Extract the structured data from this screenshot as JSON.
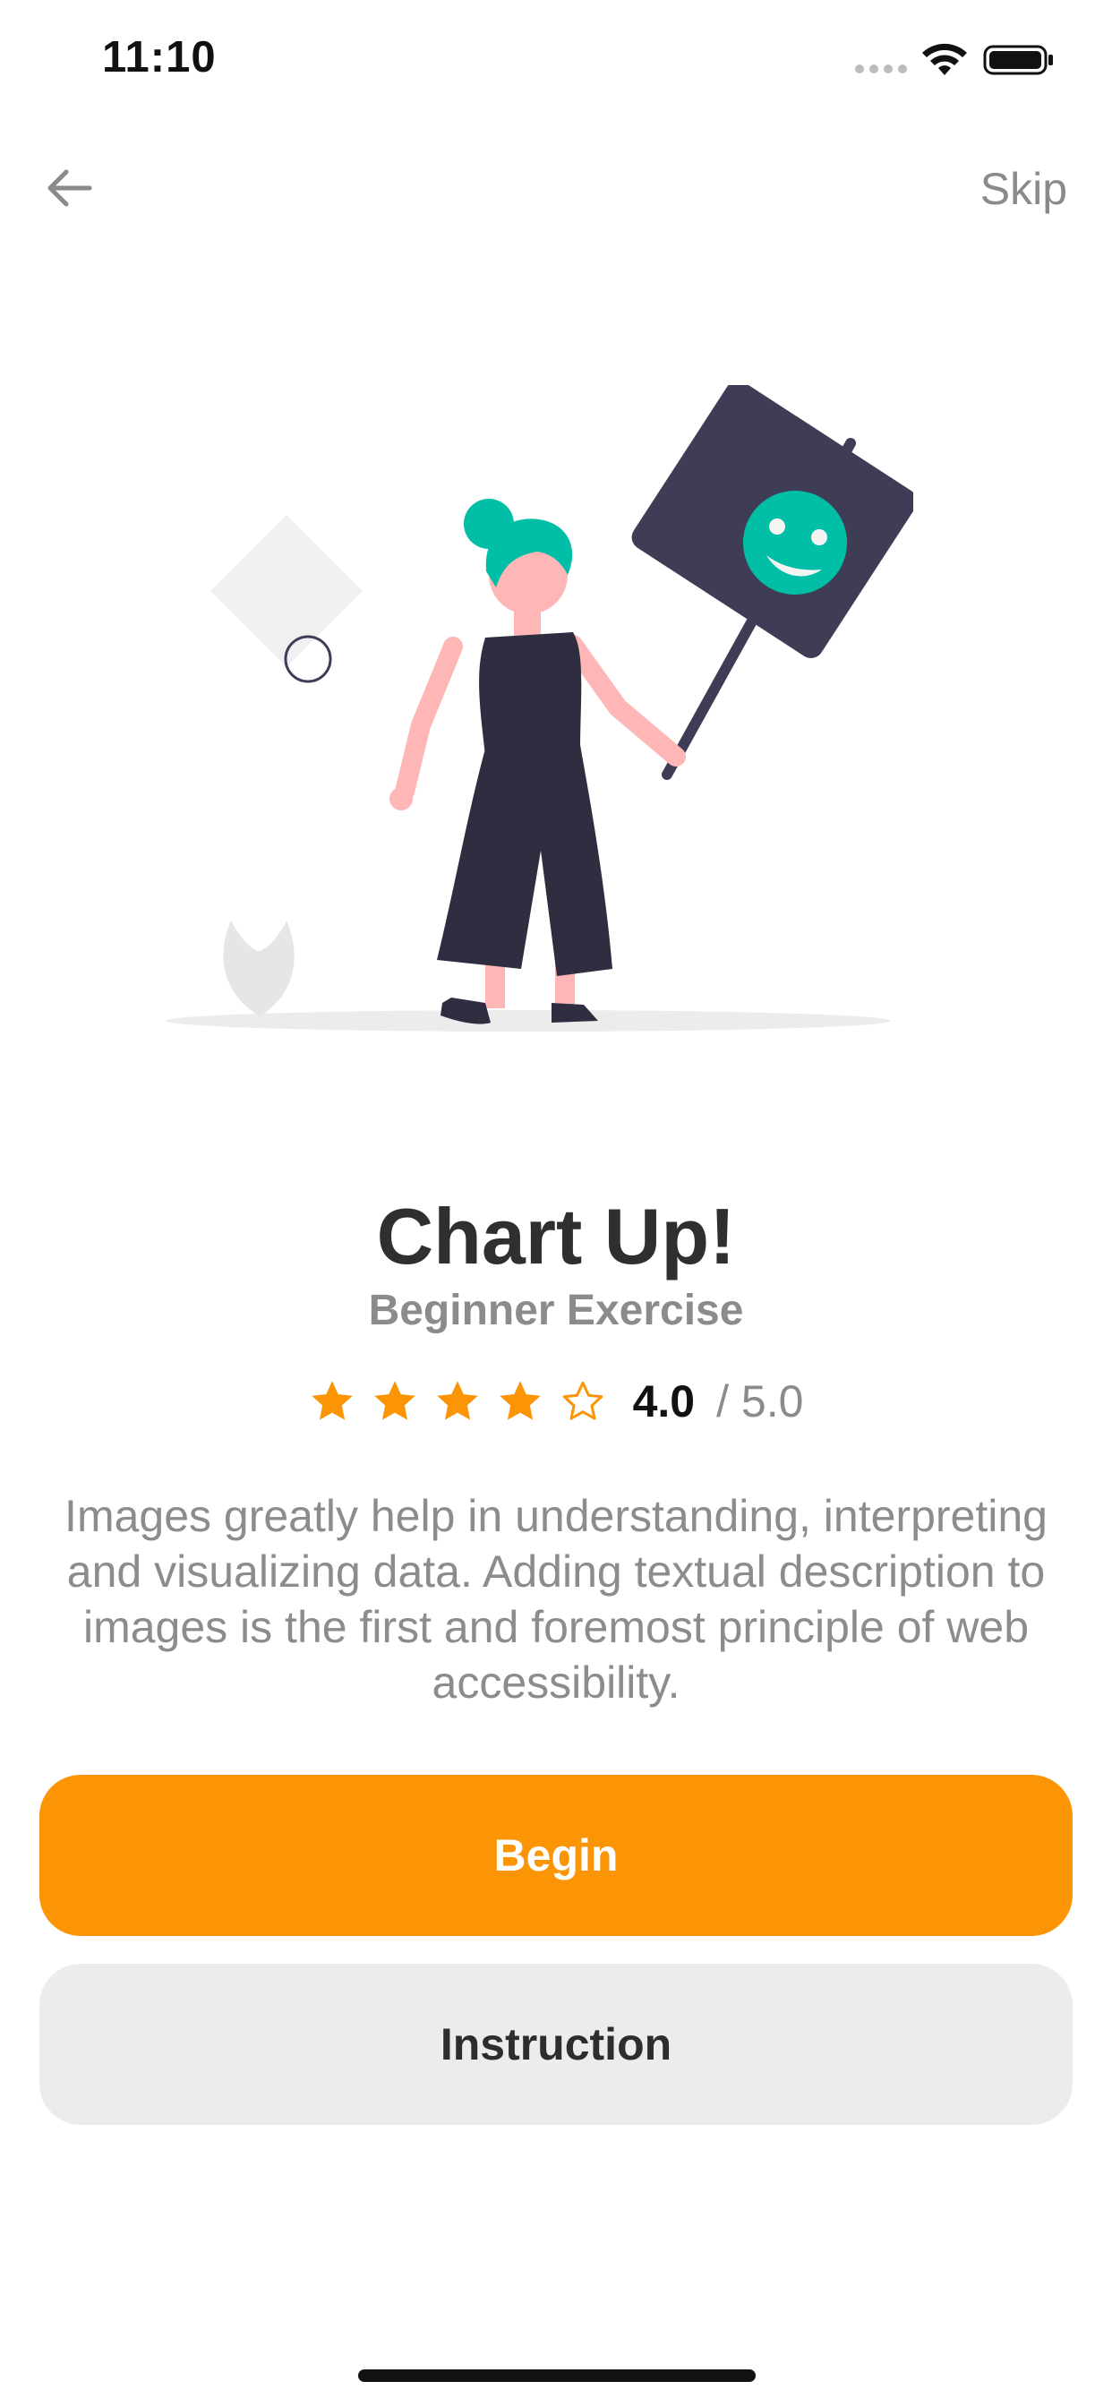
{
  "status_bar": {
    "time": "11:10"
  },
  "nav": {
    "back_icon": "arrow-left-icon",
    "skip_label": "Skip"
  },
  "illustration": {
    "icon": "woman-holding-smiley-sign-illustration"
  },
  "exercise": {
    "title": "Chart Up!",
    "subtitle": "Beginner Exercise",
    "rating": {
      "stars_filled": 4,
      "stars_total": 5,
      "value": "4.0",
      "max": "/ 5.0"
    },
    "description": "Images greatly help in understanding, interpreting and visualizing data. Adding textual description to images is the first and foremost principle of web accessibility."
  },
  "actions": {
    "begin_label": "Begin",
    "instruction_label": "Instruction"
  },
  "colors": {
    "accent": "#fc9505",
    "teal": "#00bfa6",
    "dark": "#3f3d56",
    "skin": "#ffb6b6",
    "secondary_button": "#ececec"
  }
}
